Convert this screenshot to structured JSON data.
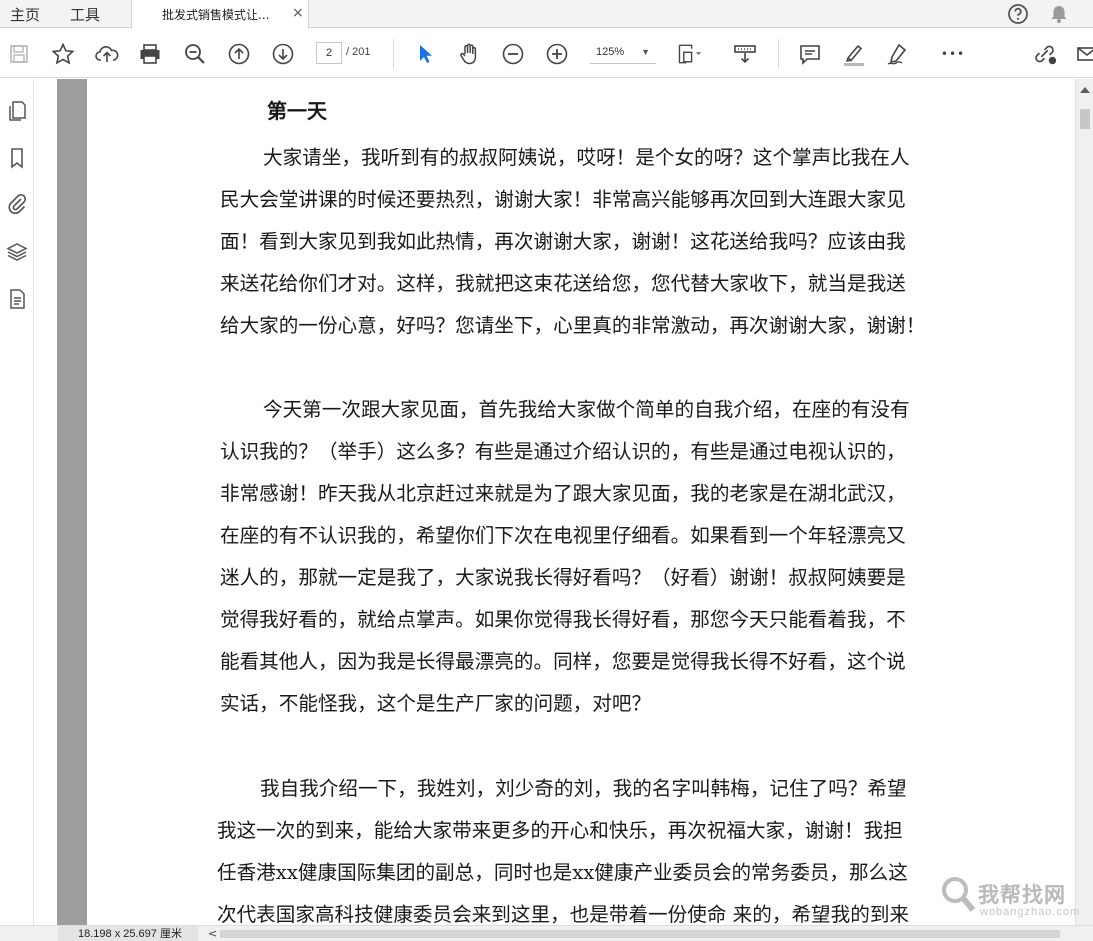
{
  "tabbar": {
    "home_label": "主页",
    "tools_label": "工具",
    "doc_tab_title": "批发式销售模式让...",
    "close_glyph": "×",
    "help_icon": "help-icon",
    "bell_icon": "bell-icon"
  },
  "toolbar": {
    "icons": [
      "save-icon",
      "star-icon",
      "upload-icon",
      "print-icon",
      "zoom-out-search-icon",
      "page-up-icon",
      "page-down-icon",
      "select-cursor-icon",
      "hand-icon",
      "zoom-minus-icon",
      "zoom-plus-icon",
      "fit-page-icon",
      "scroll-mode-icon",
      "comment-icon",
      "highlight-icon",
      "sign-icon",
      "more-icon",
      "share-link-icon",
      "email-icon"
    ],
    "current_page": "2",
    "total_pages": "/ 201",
    "zoom": "125%",
    "more_glyph": "•••",
    "accent_color": "#1473e6"
  },
  "leftrail": {
    "icons": [
      "page-thumbnails-icon",
      "bookmark-icon",
      "attachment-icon",
      "layers-icon",
      "document-properties-icon"
    ]
  },
  "document": {
    "heading": "第一天",
    "paragraph1": [
      "大家请坐，我听到有的叔叔阿姨说，哎呀！是个女的呀？这个掌声比我在人",
      "民大会堂讲课的时候还要热烈，谢谢大家！非常高兴能够再次回到大连跟大家见",
      "面！看到大家见到我如此热情，再次谢谢大家，谢谢！这花送给我吗？应该由我",
      "来送花给你们才对。这样，我就把这束花送给您，您代替大家收下，就当是我送",
      "给大家的一份心意，好吗？您请坐下，心里真的非常激动，再次谢谢大家，谢谢！"
    ],
    "paragraph2": [
      "今天第一次跟大家见面，首先我给大家做个简单的自我介绍，在座的有没有",
      "认识我的？（举手）这么多？有些是通过介绍认识的，有些是通过电视认识的，",
      "非常感谢！昨天我从北京赶过来就是为了跟大家见面，我的老家是在湖北武汉，",
      "在座的有不认识我的，希望你们下次在电视里仔细看。如果看到一个年轻漂亮又",
      "迷人的，那就一定是我了，大家说我长得好看吗？（好看）谢谢！叔叔阿姨要是",
      "觉得我好看的，就给点掌声。如果你觉得我长得好看，那您今天只能看着我，不",
      "能看其他人，因为我是长得最漂亮的。同样，您要是觉得我长得不好看，这个说",
      "实话，不能怪我，这个是生产厂家的问题，对吧？"
    ],
    "paragraph3": [
      "我自我介绍一下，我姓刘，刘少奇的刘，我的名字叫韩梅，记住了吗？希望",
      "我这一次的到来，能给大家带来更多的开心和快乐，再次祝福大家，谢谢！我担",
      "任香港xx健康国际集团的副总，同时也是xx健康产业委员会的常务委员，那么这",
      "次代表国家高科技健康委员会来到这里，也是带着一份使命  来的，希望我的到来"
    ]
  },
  "status": {
    "page_size": "18.198 x 25.697 厘米",
    "left_arrow": "<"
  },
  "watermark": {
    "text": "我帮找网",
    "sub": "wobangzhao.com"
  }
}
